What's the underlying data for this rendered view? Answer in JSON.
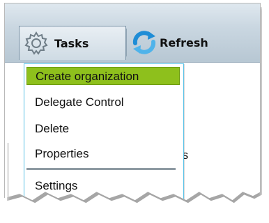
{
  "toolbar": {
    "tasks_label": "Tasks",
    "refresh_label": "Refresh"
  },
  "menu": {
    "items": [
      {
        "label": "Create organization",
        "highlighted": true
      },
      {
        "label": "Delegate Control",
        "highlighted": false
      },
      {
        "label": "Delete",
        "highlighted": false
      },
      {
        "label": "Properties",
        "highlighted": false
      },
      {
        "label": "Settings",
        "highlighted": false
      }
    ]
  },
  "background": {
    "partial_text": "gies"
  },
  "colors": {
    "highlight": "#8ec01c",
    "menu_border": "#56c1e6",
    "toolbar": "#cad7e1"
  },
  "icons": {
    "tasks": "gear-icon",
    "refresh": "refresh-icon"
  }
}
